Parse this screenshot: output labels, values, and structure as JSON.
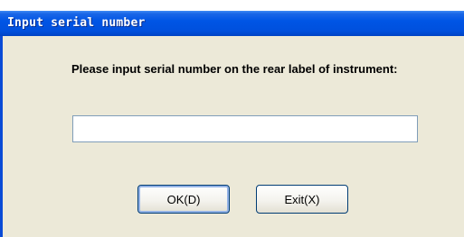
{
  "window": {
    "title": "Input serial number"
  },
  "dialog": {
    "prompt": "Please input serial number on the rear label of instrument:",
    "serial_value": "",
    "ok_label": "OK(D)",
    "exit_label": "Exit(X)"
  },
  "colors": {
    "titlebar": "#0055e5",
    "dialog_bg": "#ece9d8",
    "input_border": "#7f9db9",
    "button_border": "#003c74"
  }
}
